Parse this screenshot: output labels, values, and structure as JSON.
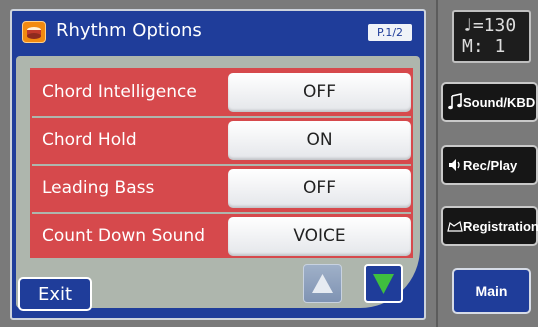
{
  "title": "Rhythm Options",
  "page_indicator": "P.1/2",
  "options": [
    {
      "label": "Chord Intelligence",
      "value": "OFF"
    },
    {
      "label": "Chord Hold",
      "value": "ON"
    },
    {
      "label": "Leading Bass",
      "value": "OFF"
    },
    {
      "label": "Count Down Sound",
      "value": "VOICE"
    }
  ],
  "exit_label": "Exit",
  "tempo": {
    "line1": "♩=130",
    "line2": "M:  1"
  },
  "side_buttons": {
    "sound_kbd": "Sound/KBD",
    "rec_play": "Rec/Play",
    "registration": "Registration",
    "main": "Main"
  },
  "colors": {
    "accent_blue": "#1f3d9a",
    "option_red": "#d6494c",
    "down_arrow": "#3fbf3f",
    "up_arrow": "#d8dde6"
  },
  "icons": [
    "rhythm-app-icon",
    "up-arrow-icon",
    "down-arrow-icon",
    "music-note-icon",
    "speaker-icon",
    "registration-icon"
  ]
}
